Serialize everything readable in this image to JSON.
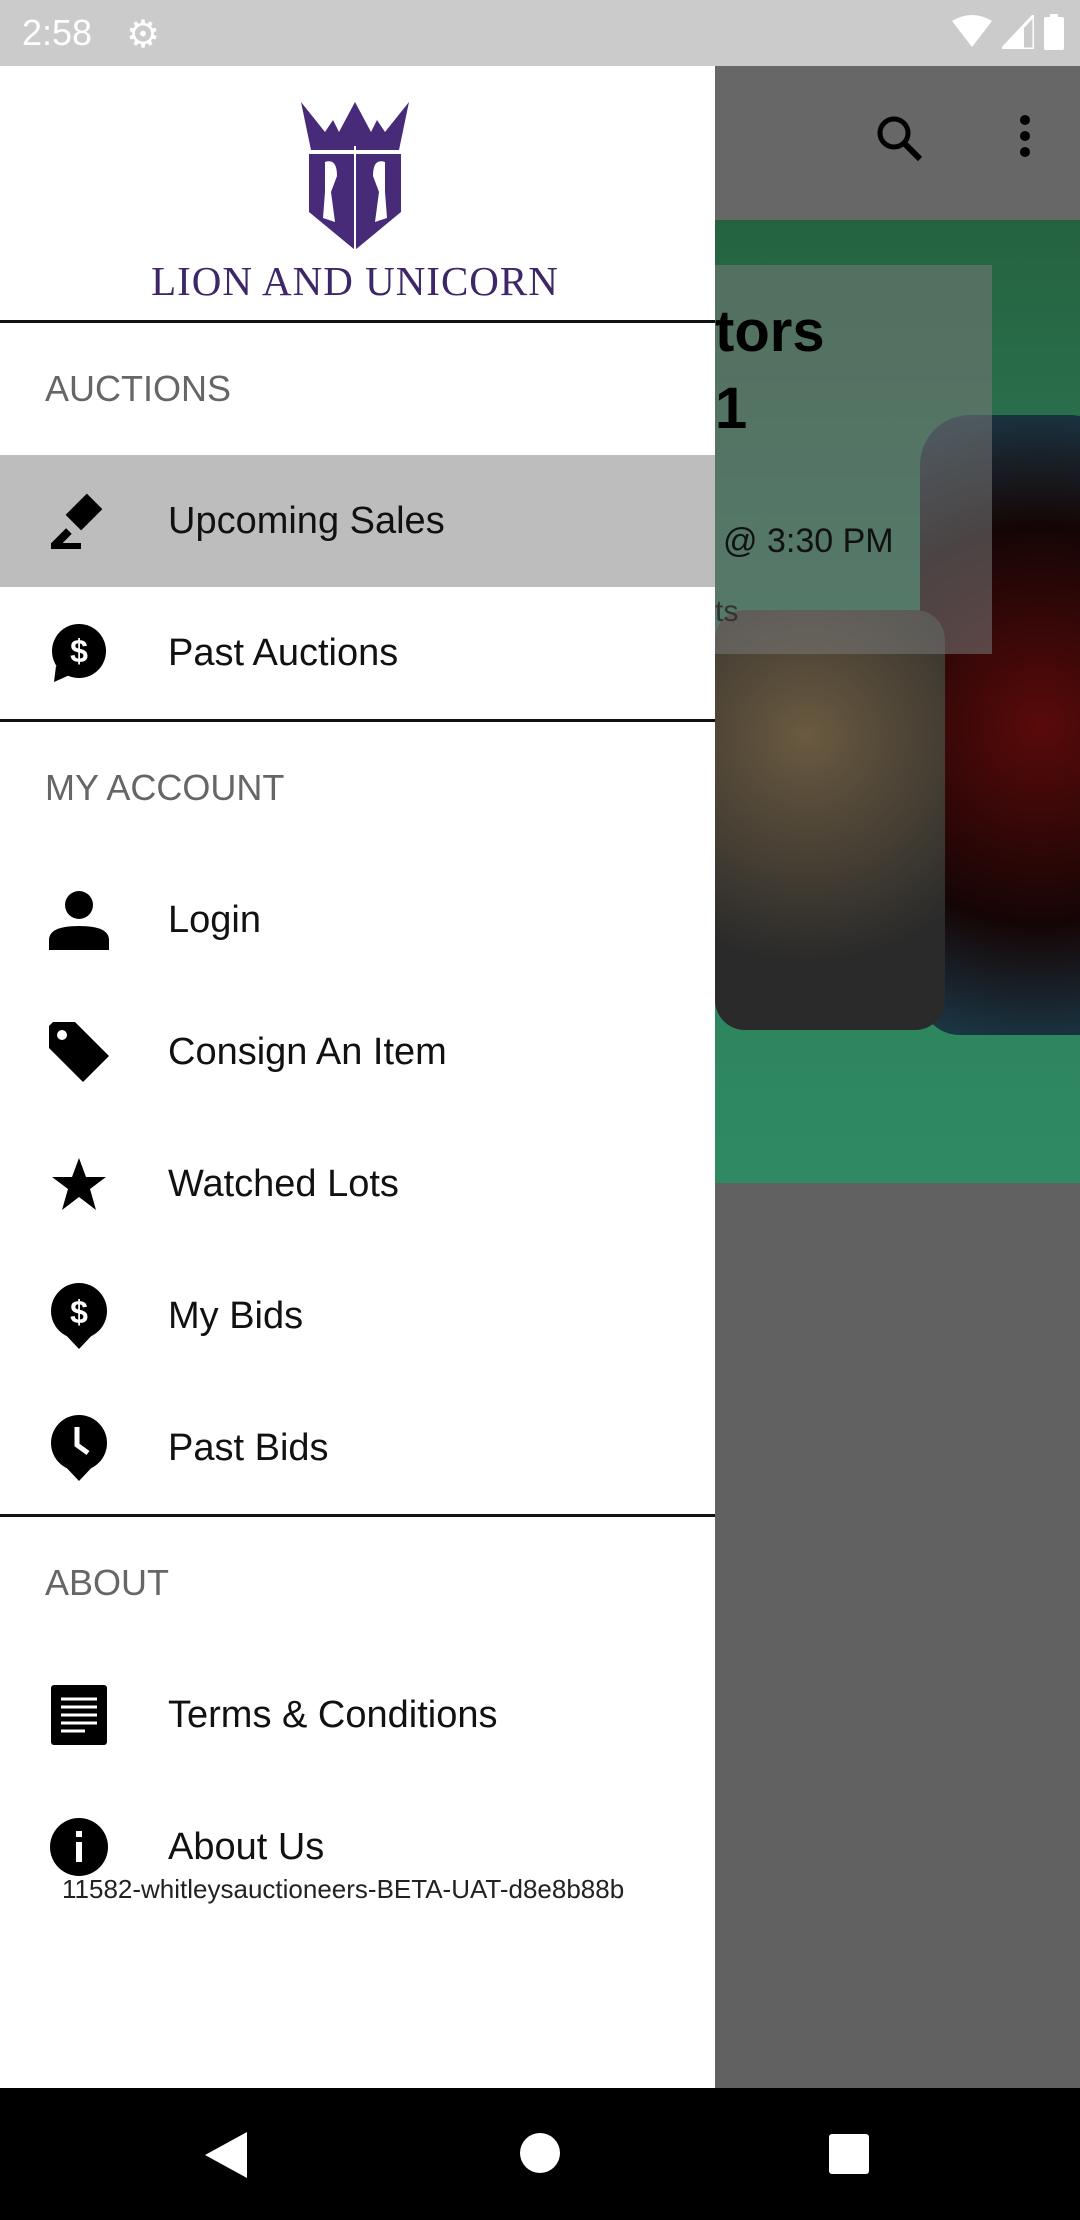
{
  "status_bar": {
    "time": "2:58",
    "icons": [
      "settings-icon",
      "wifi-icon",
      "signal-icon",
      "battery-icon"
    ]
  },
  "background": {
    "toolbar_icons": [
      "search-icon",
      "more-vert-icon"
    ],
    "hero": {
      "title_line1": "tors",
      "title_line2": "1",
      "time": "@ 3:30 PM",
      "subtitle": "ts"
    }
  },
  "drawer": {
    "logo": {
      "text": "LION AND UNICORN",
      "color": "#3d2768"
    },
    "sections": [
      {
        "title": "AUCTIONS",
        "items": [
          {
            "label": "Upcoming Sales",
            "icon": "gavel-icon",
            "active": true
          },
          {
            "label": "Past Auctions",
            "icon": "dollar-bubble-icon"
          }
        ]
      },
      {
        "title": "MY ACCOUNT",
        "items": [
          {
            "label": "Login",
            "icon": "person-icon"
          },
          {
            "label": "Consign An Item",
            "icon": "tag-icon"
          },
          {
            "label": "Watched Lots",
            "icon": "star-icon"
          },
          {
            "label": "My Bids",
            "icon": "dollar-pin-icon"
          },
          {
            "label": "Past Bids",
            "icon": "clock-pin-icon"
          }
        ]
      },
      {
        "title": "ABOUT",
        "items": [
          {
            "label": "Terms & Conditions",
            "icon": "document-icon"
          },
          {
            "label": "About Us",
            "icon": "info-icon"
          }
        ]
      }
    ],
    "version": "11582-whitleysauctioneers-BETA-UAT-d8e8b88b"
  },
  "nav_bar": {
    "buttons": [
      "back",
      "home",
      "recents"
    ]
  }
}
